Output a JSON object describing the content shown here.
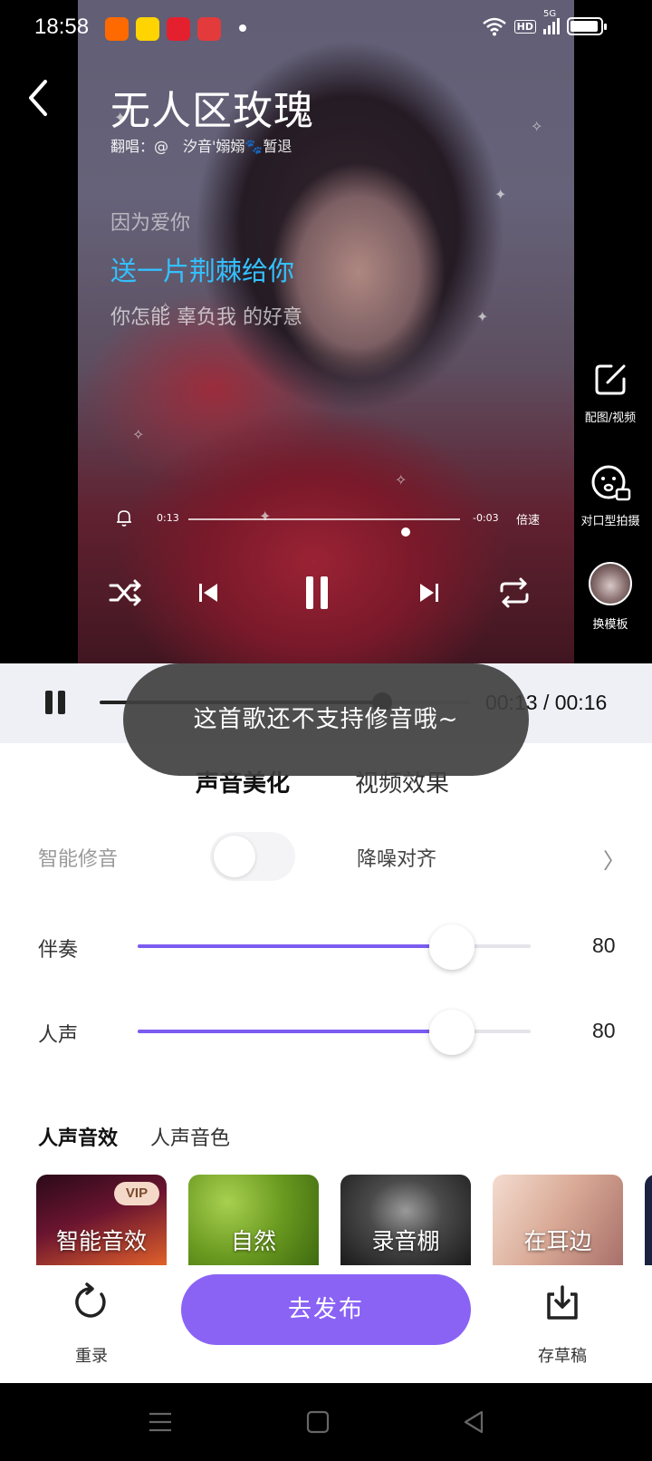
{
  "status_bar": {
    "time": "18:58",
    "app_icons": [
      {
        "name": "kuaishou-app-icon",
        "color": "#ff6a00"
      },
      {
        "name": "game-center-app-icon",
        "color": "#ffd400"
      },
      {
        "name": "mini-program-app-icon",
        "color": "#e5202e"
      },
      {
        "name": "video-app-icon",
        "color": "#e33b3b"
      }
    ],
    "hd_label": "HD",
    "network_label": "5G"
  },
  "song": {
    "title": "无人区玫瑰",
    "singer_line": "翻唱：@　汐音'嫋嫋🐾暂退"
  },
  "lyrics": {
    "previous": "因为爱你",
    "current": "送一片荆棘给你",
    "next": "你怎能 辜负我 的好意"
  },
  "side_tools": {
    "picture_video": "配图/视频",
    "lip_sync": "对口型拍摄",
    "change_template": "换模板"
  },
  "player": {
    "elapsed": "0:13",
    "remaining": "-0:03",
    "speed_label": "倍速",
    "progress": 0.8
  },
  "preview": {
    "time_display": "00:13 / 00:16",
    "progress": 0.76
  },
  "tabs": {
    "voice": "声音美化",
    "video": "视频效果"
  },
  "smart_tune": {
    "label": "智能修音",
    "enabled": false,
    "align_label": "降噪对齐",
    "chevron": "〉"
  },
  "mix": {
    "accompaniment_label": "伴奏",
    "accompaniment_value": "80",
    "vocal_label": "人声",
    "vocal_value": "80",
    "max": 100
  },
  "effect_tabs": {
    "effects": "人声音效",
    "timbre": "人声音色"
  },
  "effects": [
    {
      "name": "智能音效",
      "vip": "VIP"
    },
    {
      "name": "自然"
    },
    {
      "name": "录音棚"
    },
    {
      "name": "在耳边"
    }
  ],
  "actions": {
    "rerecord": "重录",
    "publish": "去发布",
    "save_draft": "存草稿"
  },
  "toast": "这首歌还不支持修音哦~",
  "colors": {
    "accent": "#8a63f5",
    "lyric_highlight": "#34c0ff",
    "tab_underline": "#ffe14d"
  }
}
